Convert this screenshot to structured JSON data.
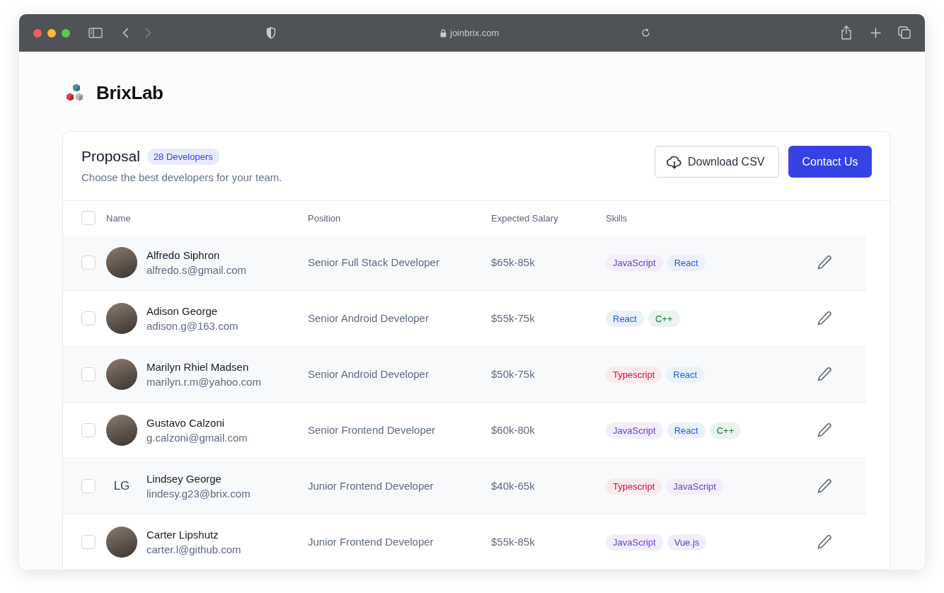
{
  "browser": {
    "url": "joinbrix.com"
  },
  "brand": {
    "name": "BrixLab"
  },
  "proposal": {
    "title": "Proposal",
    "badge": "28 Developers",
    "subtitle": "Choose the best developers for your team.",
    "buttons": [
      {
        "label": "Download CSV",
        "kind": "secondary"
      },
      {
        "label": "Contact Us",
        "kind": "primary"
      }
    ]
  },
  "table": {
    "select_all_checked": false,
    "columns": [
      "Name",
      "Position",
      "Expected Salary",
      "Skills"
    ],
    "rows": [
      {
        "name": "Alfredo Siphron",
        "email": "alfredo.s@gmail.com",
        "avatar": {
          "kind": "photo"
        },
        "position": "Senior Full Stack Developer",
        "salary": "$65k-85k",
        "checked": false,
        "skills": [
          {
            "label": "JavaScript",
            "color": "#6d3fd2"
          },
          {
            "label": "React",
            "color": "#1d5fd6"
          }
        ]
      },
      {
        "name": "Adison George",
        "email": "adison.g@163.com",
        "avatar": {
          "kind": "photo"
        },
        "position": "Senior Android Developer",
        "salary": "$55k-75k",
        "checked": false,
        "skills": [
          {
            "label": "React",
            "color": "#1d5fd6"
          },
          {
            "label": "C++",
            "color": "#137a3d"
          }
        ]
      },
      {
        "name": "Marilyn Rhiel Madsen",
        "email": "marilyn.r.m@yahoo.com",
        "avatar": {
          "kind": "photo"
        },
        "position": "Senior Android Developer",
        "salary": "$50k-75k",
        "checked": false,
        "skills": [
          {
            "label": "Typescript",
            "color": "#c8123f"
          },
          {
            "label": "React",
            "color": "#1d5fd6"
          }
        ]
      },
      {
        "name": "Gustavo Calzoni",
        "email": "g.calzoni@gmail.com",
        "avatar": {
          "kind": "photo"
        },
        "position": "Senior Frontend Developer",
        "salary": "$60k-80k",
        "checked": false,
        "skills": [
          {
            "label": "JavaScript",
            "color": "#6d3fd2"
          },
          {
            "label": "React",
            "color": "#1d5fd6"
          },
          {
            "label": "C++",
            "color": "#137a3d"
          }
        ]
      },
      {
        "name": "Lindsey George",
        "email": "lindesy.g23@brix.com",
        "avatar": {
          "kind": "initials",
          "text": "LG"
        },
        "position": "Junior Frontend Developer",
        "salary": "$40k-65k",
        "checked": false,
        "skills": [
          {
            "label": "Typescript",
            "color": "#c8123f"
          },
          {
            "label": "JavaScript",
            "color": "#6d3fd2"
          }
        ]
      },
      {
        "name": "Carter Lipshutz",
        "email": "carter.l@github.com",
        "avatar": {
          "kind": "photo"
        },
        "position": "Junior Frontend Developer",
        "salary": "$55k-85k",
        "checked": false,
        "skills": [
          {
            "label": "JavaScript",
            "color": "#6d3fd2"
          },
          {
            "label": "Vue.js",
            "color": "#4a3fd6"
          }
        ]
      }
    ]
  }
}
